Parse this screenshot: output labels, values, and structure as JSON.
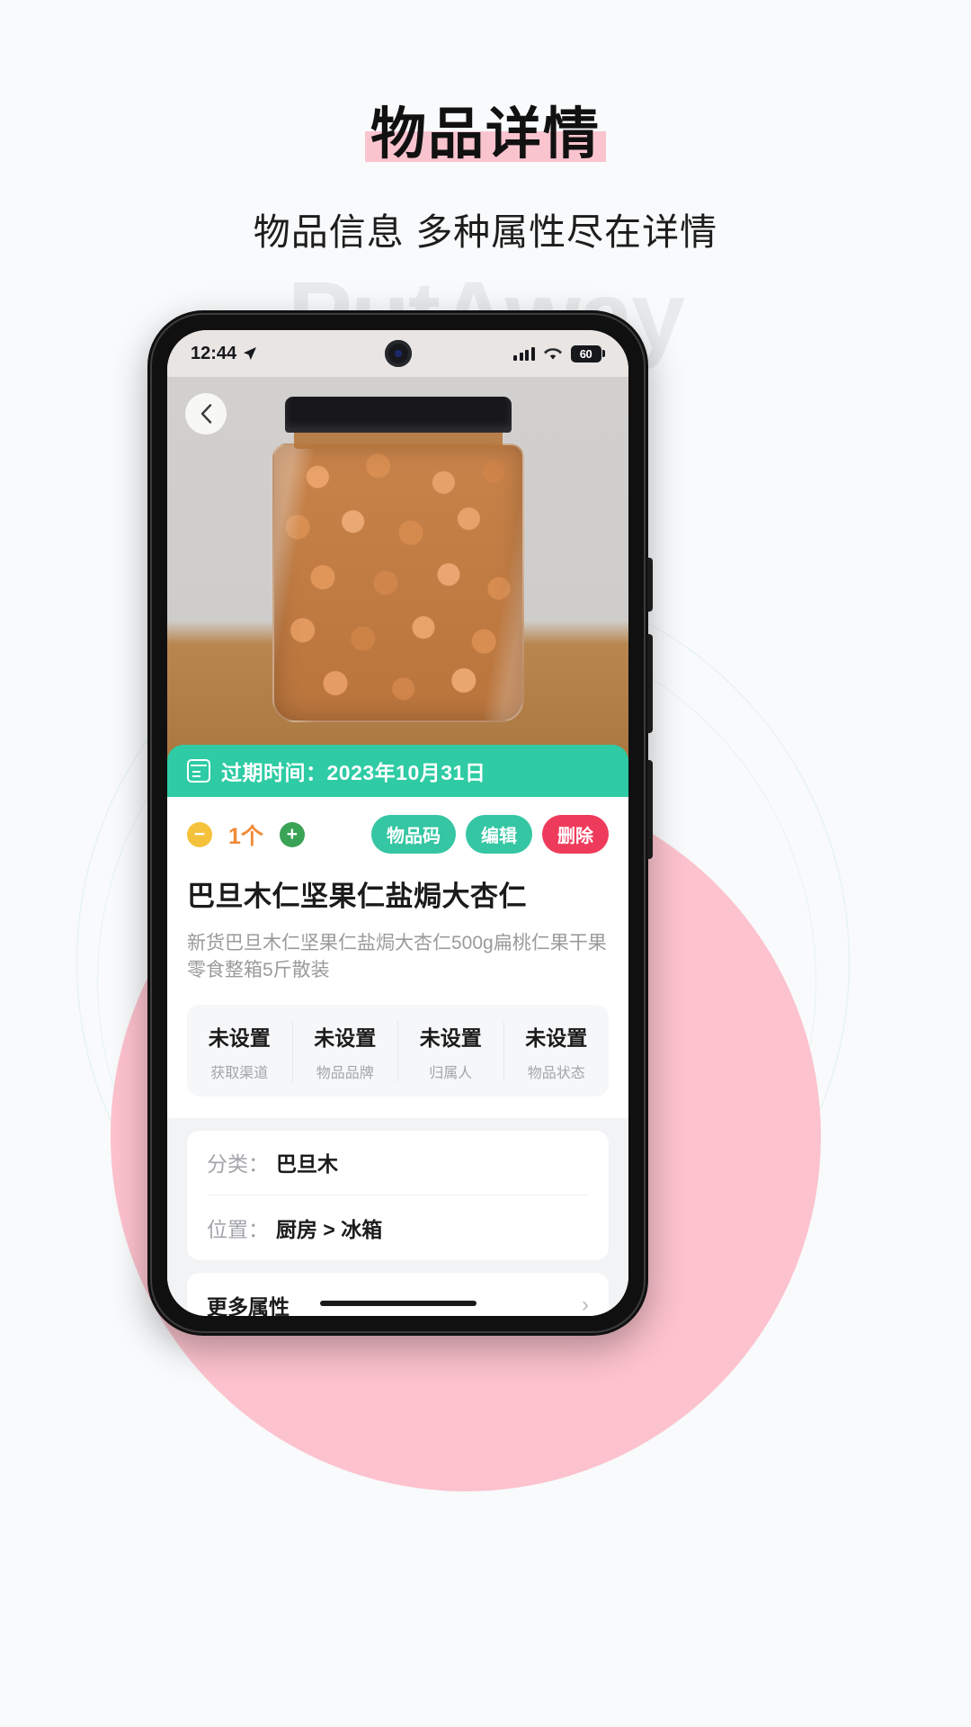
{
  "header": {
    "title": "物品详情",
    "subtitle": "物品信息 多种属性尽在详情",
    "highlight_color": "#fac4cf"
  },
  "background": {
    "watermark": "PutAway",
    "circle_color": "#fcc2cd",
    "ring_color": "#dff2ec"
  },
  "phone": {
    "status_bar": {
      "time": "12:44",
      "location_icon": "location-arrow-icon",
      "signal_icon": "signal-bars-icon",
      "wifi_icon": "wifi-icon",
      "battery_level": "60"
    },
    "hero": {
      "back_icon": "chevron-left-icon",
      "image_alt": "almond-jar-photo"
    },
    "expiry": {
      "icon": "calendar-icon",
      "text": "过期时间：2023年10月31日",
      "bg_color": "#2ecba4"
    },
    "quantity": {
      "minus_label": "−",
      "value": "1个",
      "plus_label": "+",
      "minus_color": "#f5c33b",
      "plus_color": "#3aa356",
      "value_color": "#f08a36"
    },
    "actions": [
      {
        "label": "物品码",
        "style": "teal"
      },
      {
        "label": "编辑",
        "style": "teal"
      },
      {
        "label": "删除",
        "style": "red"
      }
    ],
    "item": {
      "title": "巴旦木仁坚果仁盐焗大杏仁",
      "description": "新货巴旦木仁坚果仁盐焗大杏仁500g扁桃仁果干果零食整箱5斤散装"
    },
    "attributes": [
      {
        "value": "未设置",
        "label": "获取渠道"
      },
      {
        "value": "未设置",
        "label": "物品品牌"
      },
      {
        "value": "未设置",
        "label": "归属人"
      },
      {
        "value": "未设置",
        "label": "物品状态"
      }
    ],
    "meta_rows": [
      {
        "label": "分类：",
        "value": "巴旦木"
      },
      {
        "label": "位置：",
        "value": "厨房 > 冰箱"
      }
    ],
    "more": {
      "label": "更多属性",
      "chevron": "›"
    }
  }
}
